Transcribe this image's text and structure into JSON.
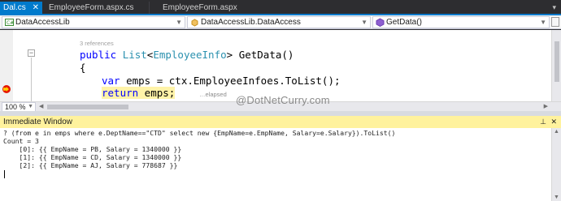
{
  "tabs": [
    {
      "label": "Dal.cs",
      "active": true
    },
    {
      "label": "EmployeeForm.aspx.cs",
      "active": false
    },
    {
      "label": "EmployeeForm.aspx",
      "active": false
    }
  ],
  "navbar": {
    "project": "DataAccessLib",
    "class": "DataAccessLib.DataAccess",
    "member": "GetData()"
  },
  "editor": {
    "codelens": "3 references",
    "line_sig": {
      "kw": "public",
      "type1": "List",
      "lt": "<",
      "type2": "EmployeeInfo",
      "rest": "> GetData()"
    },
    "line_brace": "{",
    "line_var": {
      "kw": "var",
      "rest": " emps = ctx.EmployeeInfoes.ToList();"
    },
    "line_return": {
      "kw": "return",
      "rest": " emps;"
    },
    "elapsed": "…elapsed",
    "zoom": "100 %"
  },
  "watermark": "@DotNetCurry.com",
  "immediate": {
    "title": "Immediate Window",
    "lines": [
      "? (from e in emps where e.DeptName==\"CTD\" select new {EmpName=e.EmpName, Salary=e.Salary}).ToList()",
      "Count = 3",
      "    [0]: {{ EmpName = PB, Salary = 1340000 }}",
      "    [1]: {{ EmpName = CD, Salary = 1340000 }}",
      "    [2]: {{ EmpName = AJ, Salary = 778687 }}"
    ]
  },
  "colors": {
    "accent": "#007acc",
    "keyword": "#0000ff",
    "type": "#2b91af",
    "immediate_title_bg": "#fff29d",
    "breakpoint": "#e51400"
  }
}
